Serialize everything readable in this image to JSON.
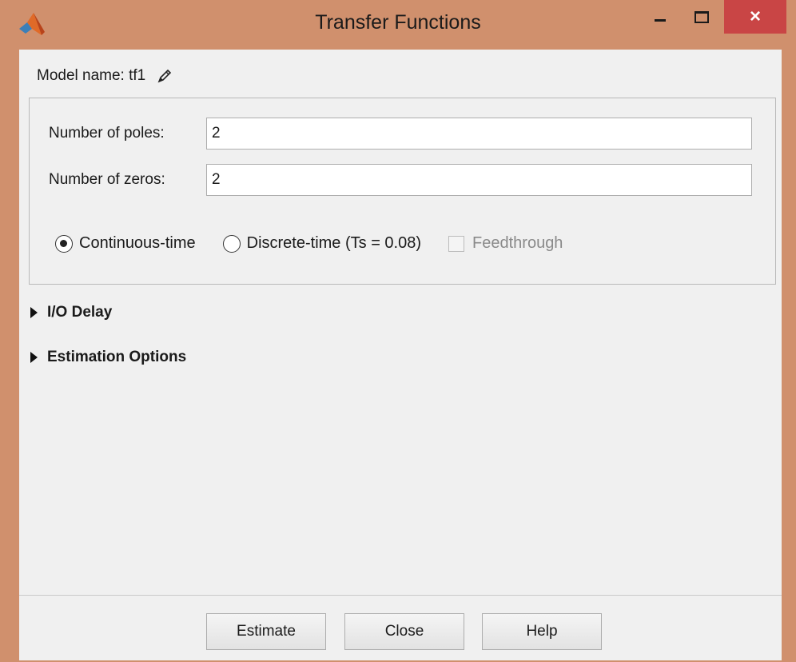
{
  "window": {
    "title": "Transfer Functions",
    "close_glyph": "×",
    "accent_color": "#d0906d",
    "close_color": "#c94545"
  },
  "model": {
    "label": "Model name: tf1",
    "edit_icon": "pencil-icon"
  },
  "fields": {
    "poles_label": "Number of poles:",
    "poles_value": "2",
    "zeros_label": "Number of zeros:",
    "zeros_value": "2"
  },
  "options": {
    "continuous_label": "Continuous-time",
    "continuous_selected": true,
    "discrete_label": "Discrete-time (Ts = 0.08)",
    "discrete_selected": false,
    "feedthrough_label": "Feedthrough",
    "feedthrough_enabled": false
  },
  "sections": {
    "io_delay": "I/O Delay",
    "estimation_options": "Estimation Options"
  },
  "footer": {
    "estimate_label": "Estimate",
    "close_label": "Close",
    "help_label": "Help"
  }
}
